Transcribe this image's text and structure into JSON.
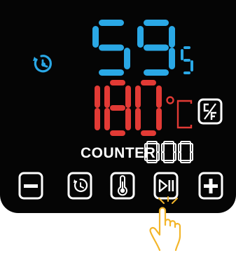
{
  "display": {
    "time": {
      "value": "59",
      "unit": "s",
      "color": "#2aa8e6"
    },
    "temperature": {
      "value": "180",
      "unit": "°C",
      "color": "#e23a35"
    },
    "conversion_toggle": {
      "label": "C/F",
      "icon": "c-f-toggle-icon"
    },
    "counter": {
      "label": "COUNTER",
      "value": "000"
    }
  },
  "controls": [
    {
      "name": "minus",
      "icon": "minus-icon"
    },
    {
      "name": "timer",
      "icon": "timer-icon"
    },
    {
      "name": "temperature",
      "icon": "thermometer-icon"
    },
    {
      "name": "play-pause",
      "icon": "play-pause-icon"
    },
    {
      "name": "plus",
      "icon": "plus-icon"
    }
  ],
  "pointer": {
    "icon": "tapping-hand-icon",
    "target": "play-pause"
  },
  "colors": {
    "panel": "#050505",
    "blue": "#2aa8e6",
    "red": "#e23a35",
    "white": "#ffffff",
    "hand": "#f3b52a"
  }
}
